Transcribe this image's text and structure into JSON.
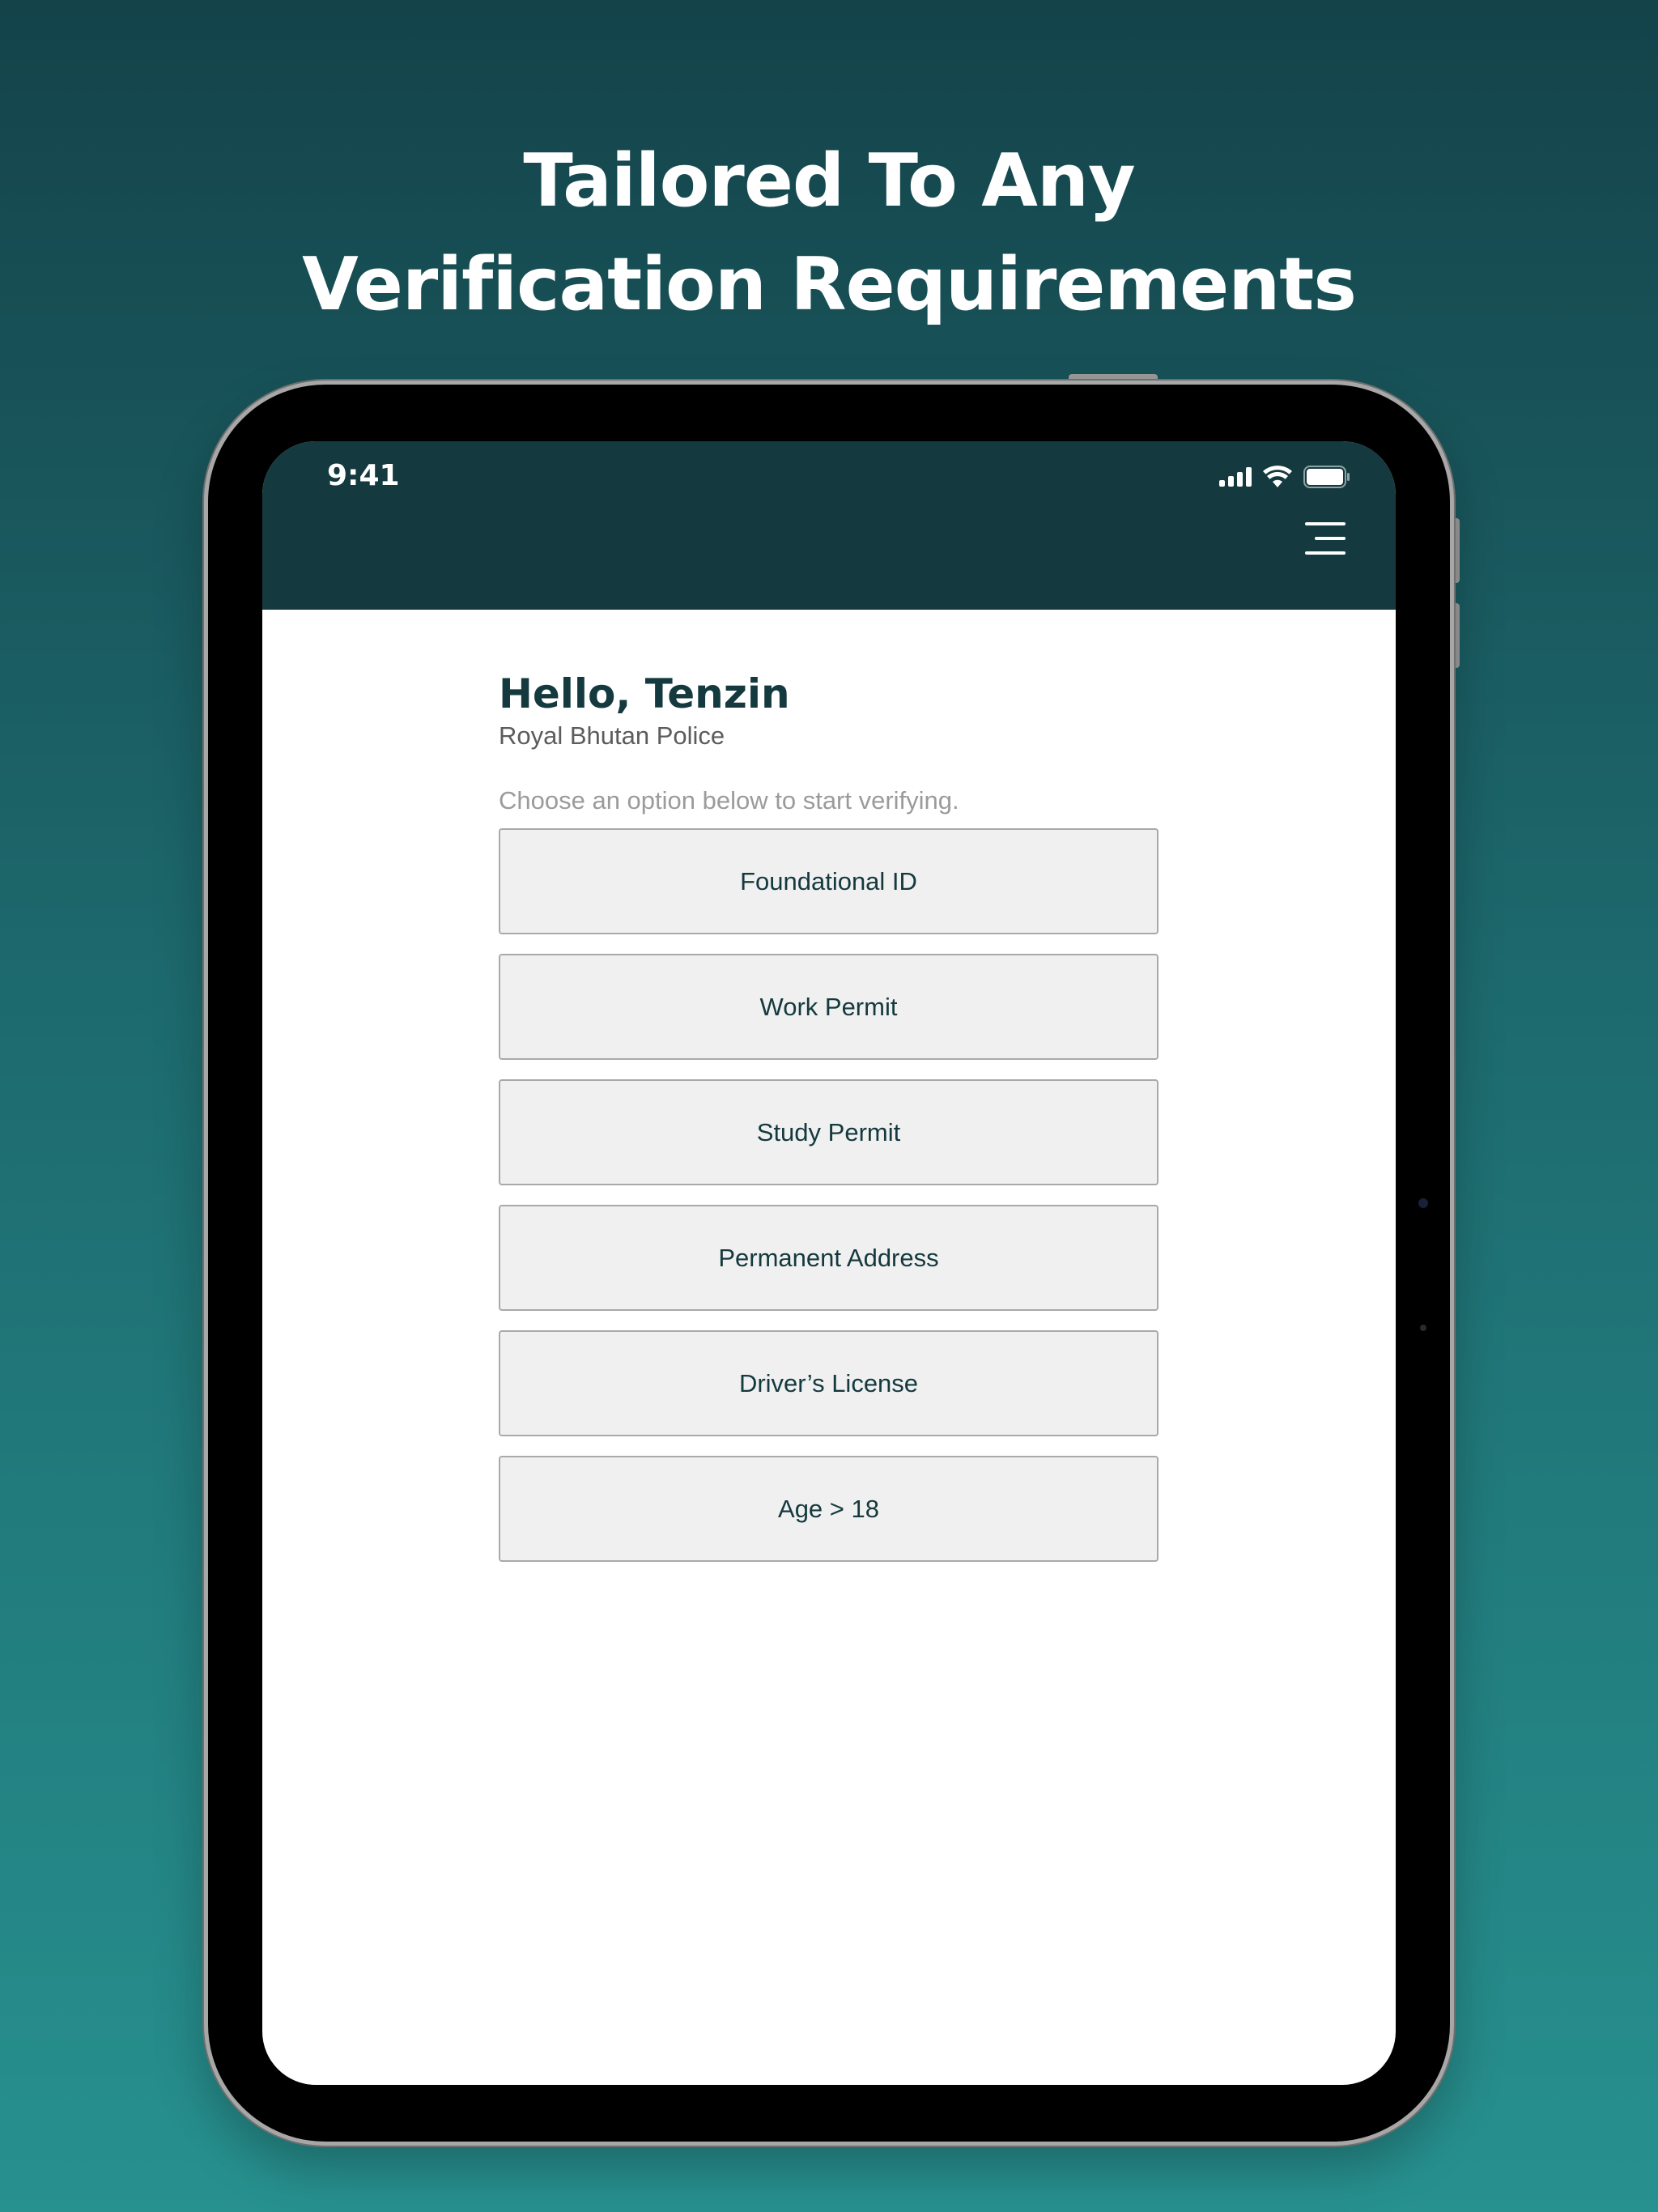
{
  "headline": {
    "line1": "Tailored To Any",
    "line2": "Verification Requirements"
  },
  "status_bar": {
    "time": "9:41",
    "icons": [
      "cellular-signal-icon",
      "wifi-icon",
      "battery-icon"
    ]
  },
  "header": {
    "menu_icon": "hamburger-menu-icon"
  },
  "main": {
    "greeting": "Hello, Tenzin",
    "organization": "Royal Bhutan Police",
    "instruction": "Choose an option below to start verifying.",
    "options": [
      "Foundational ID",
      "Work Permit",
      "Study Permit",
      "Permanent Address",
      "Driver’s License",
      "Age > 18"
    ]
  },
  "colors": {
    "background_top": "#14434a",
    "background_bottom": "#27918f",
    "header_bg": "#14393e",
    "text_dark": "#14393e",
    "button_bg": "#f0f0f0",
    "button_border": "#a9a9a9"
  }
}
